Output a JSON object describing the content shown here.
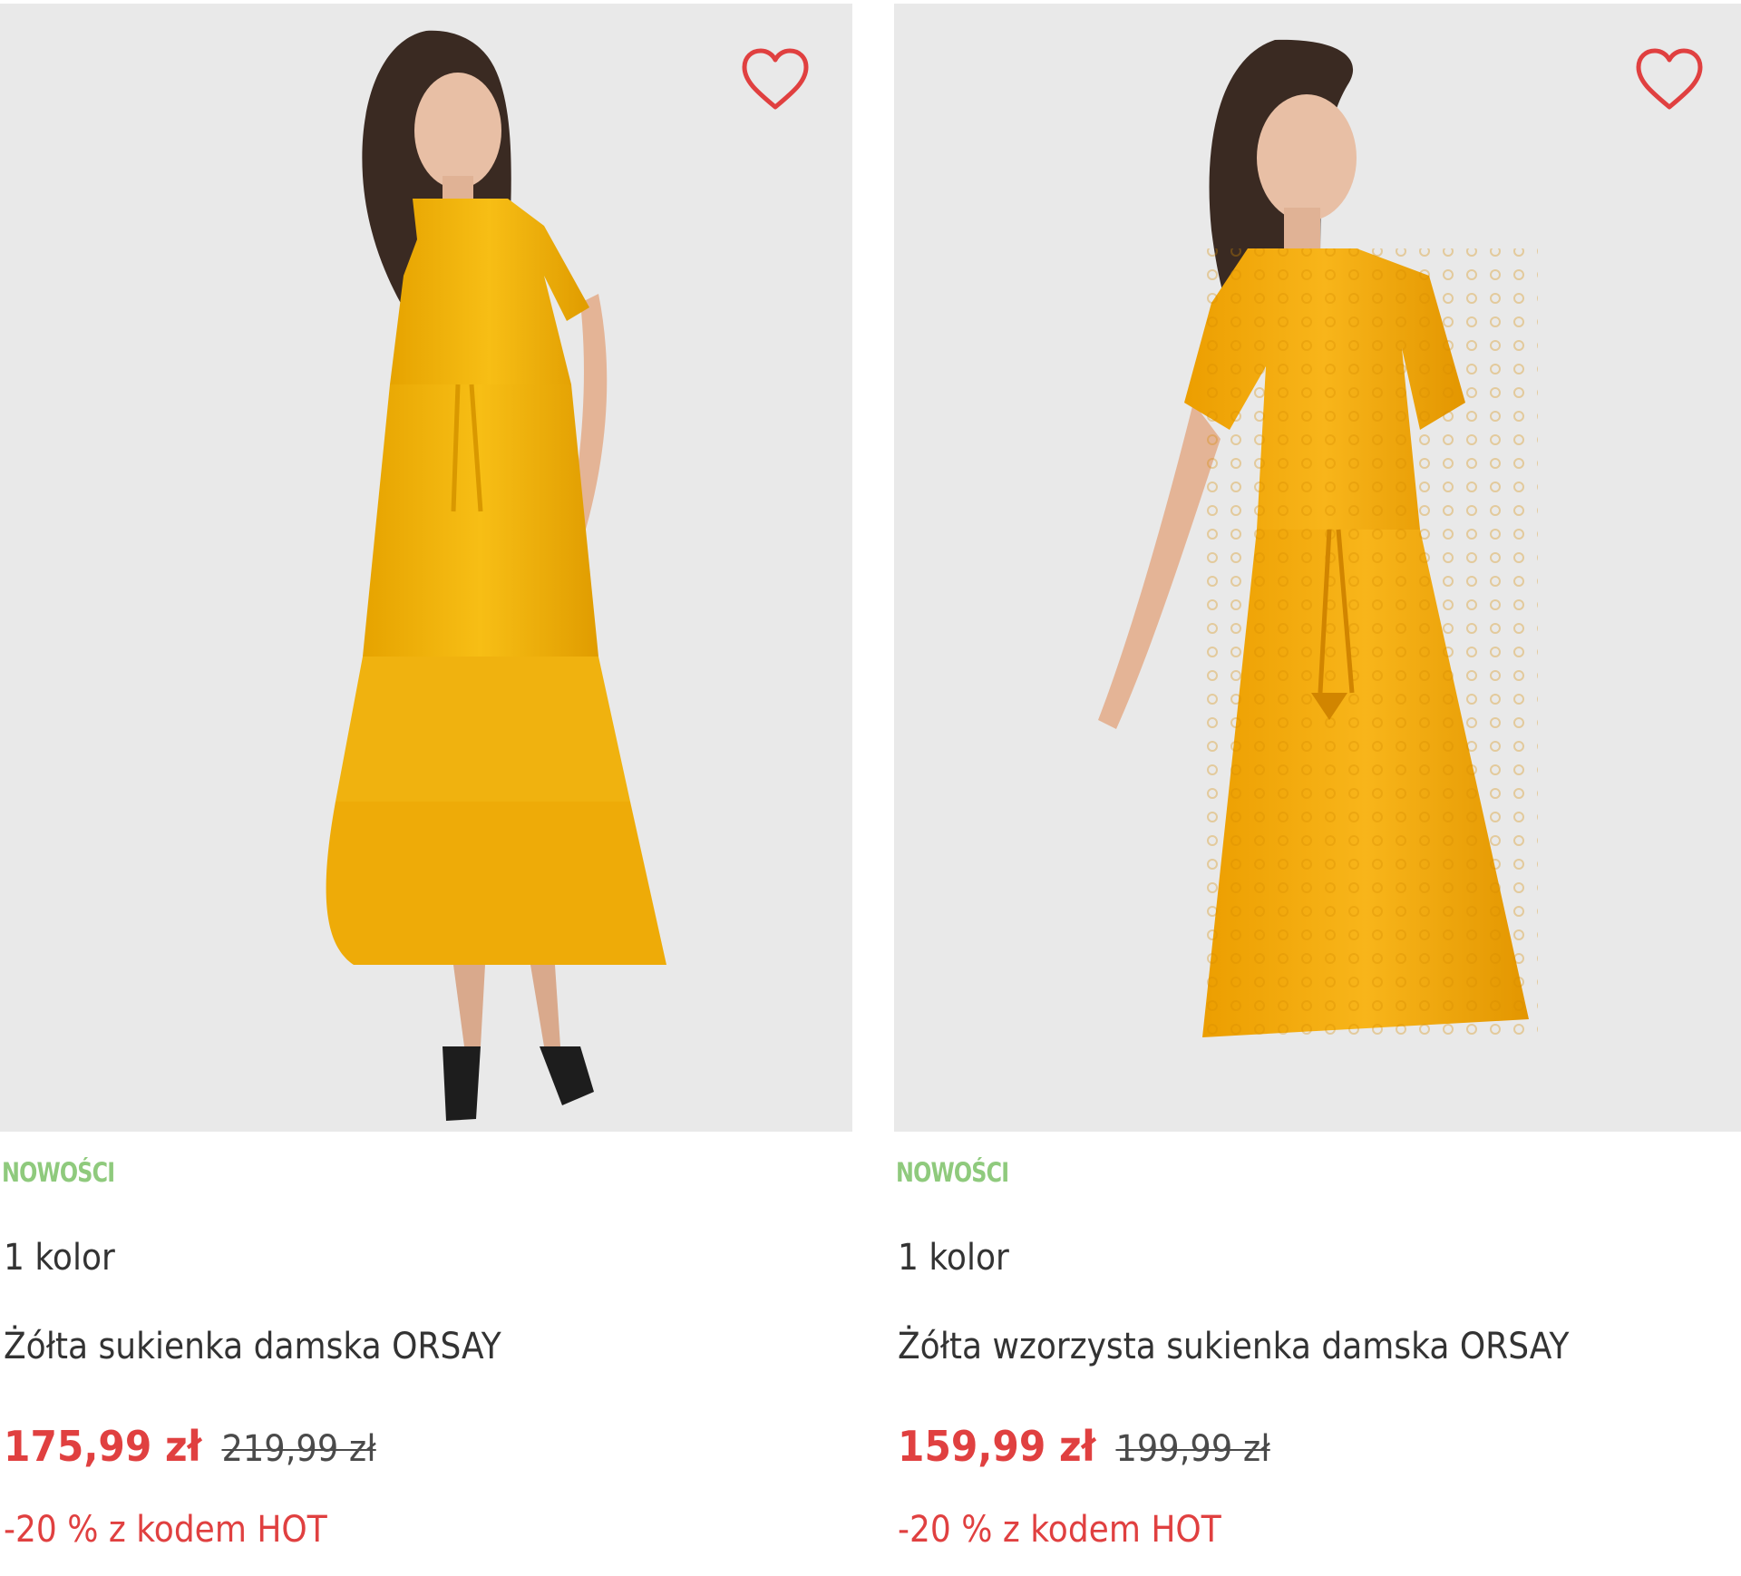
{
  "colors": {
    "badge": "#8fca7d",
    "price_current": "#e04040",
    "price_old": "#4a4a4a",
    "promo": "#e04040",
    "wishlist_icon": "#e04040",
    "dress_primary": "#f2b712",
    "photo_background": "#e9e9e9"
  },
  "products": [
    {
      "image": "yellow-maxi-dress-photo",
      "wishlist_icon": "heart-outline-icon",
      "badge": "NOWOŚCI",
      "colors_count": "1 kolor",
      "name": "Żółta sukienka damska ORSAY",
      "price_current": "175,99 zł",
      "price_old": "219,99 zł",
      "promo": "-20 % z kodem HOT"
    },
    {
      "image": "yellow-lace-dress-photo",
      "wishlist_icon": "heart-outline-icon",
      "badge": "NOWOŚCI",
      "colors_count": "1 kolor",
      "name": "Żółta wzorzysta sukienka damska ORSAY",
      "price_current": "159,99 zł",
      "price_old": "199,99 zł",
      "promo": "-20 % z kodem HOT"
    }
  ]
}
